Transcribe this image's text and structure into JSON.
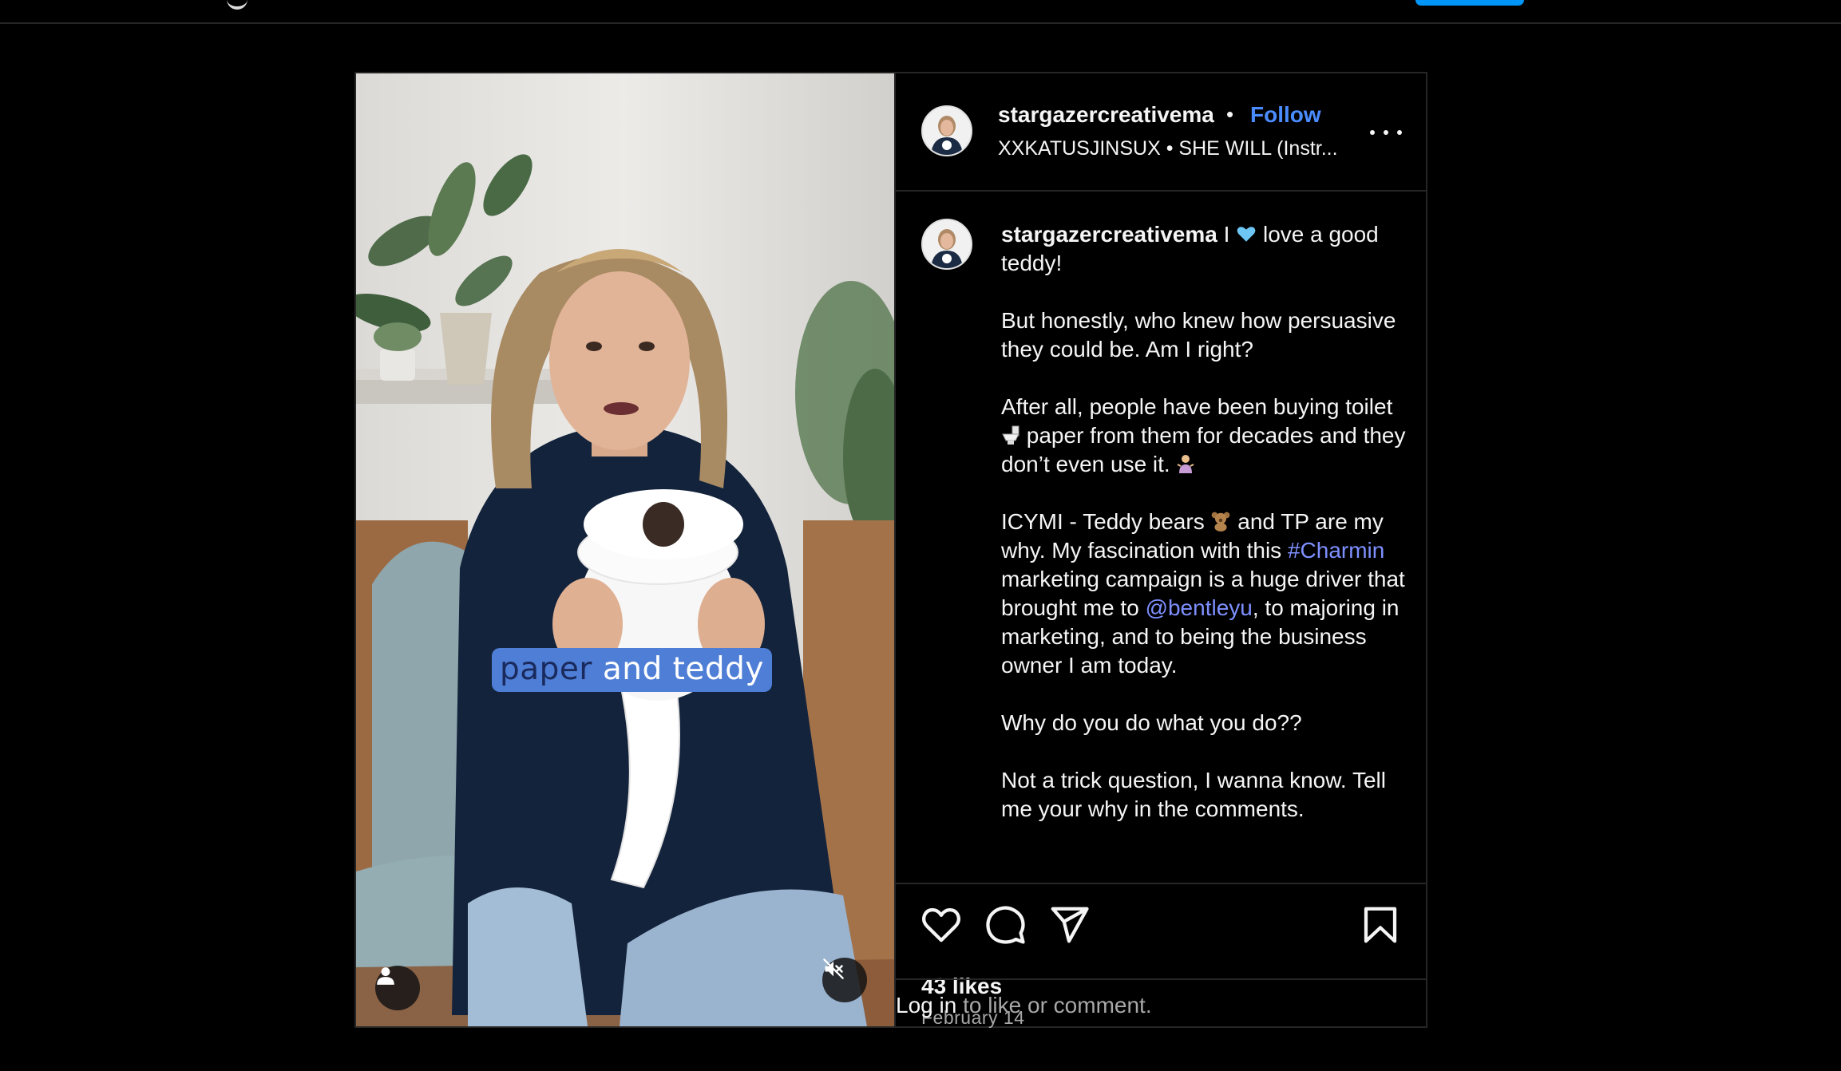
{
  "post": {
    "username": "stargazercreativema",
    "follow_label": "Follow",
    "separator": "•",
    "audio_artist": "XXKATUSJINSUX",
    "audio_title": "SHE WILL (Instr...",
    "video_caption_word1": "paper",
    "video_caption_word2": "and teddy",
    "caption": {
      "line1_a": "I",
      "line1_b": "love a good teddy!",
      "p2": "But honestly, who knew how persuasive they could be. Am I right?",
      "p3_a": "After all, people have been buying toilet",
      "p3_b": "paper from them for decades and they don’t even use it.",
      "p4_a": "ICYMI - Teddy bears",
      "p4_b": "and TP are my why. My fascination with this",
      "hashtag": "#Charmin",
      "p4_c": "marketing campaign is a huge driver that brought me to",
      "mention": "@bentleyu",
      "p4_d": ", to majoring in marketing, and to being the business owner I am today.",
      "p5": "Why do you do what you do??",
      "p6": "Not a trick question, I wanna know. Tell me your why in the comments."
    },
    "likes": "43 likes",
    "date": "February 14",
    "login_link": "Log in",
    "login_rest": "to like or comment."
  },
  "icons": [
    "like-icon",
    "comment-icon",
    "share-icon",
    "save-icon",
    "more-icon",
    "user-tag-icon",
    "mute-icon"
  ],
  "colors": {
    "accent": "#4a8cff",
    "link": "#7e90ff",
    "background": "#000000",
    "border": "#262626"
  }
}
